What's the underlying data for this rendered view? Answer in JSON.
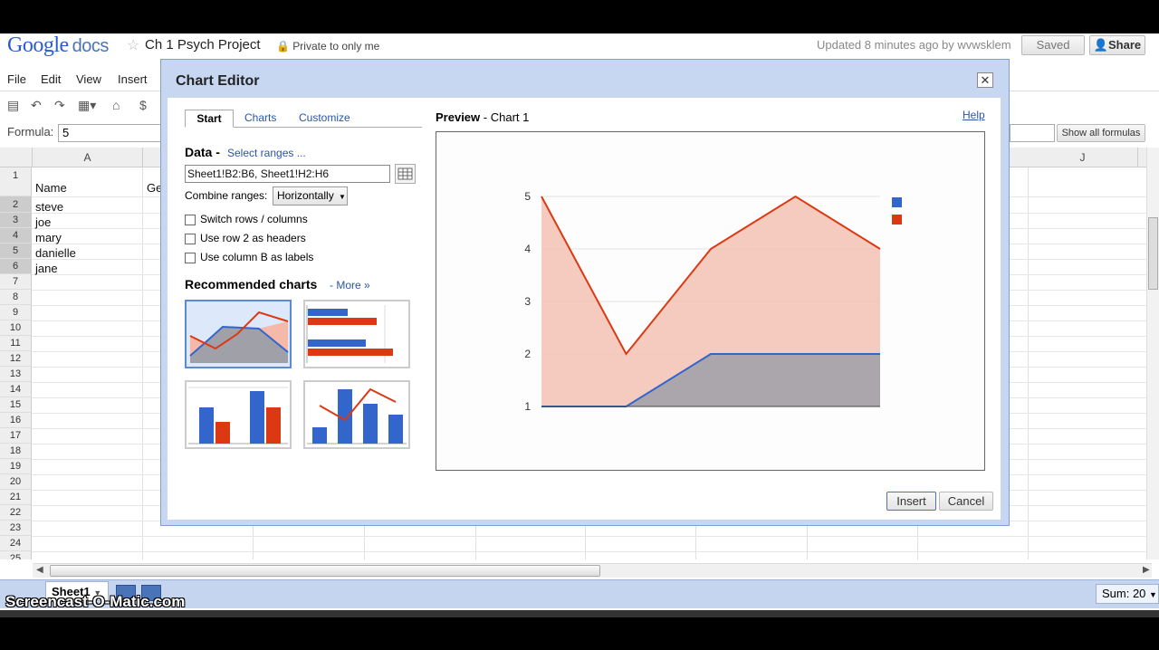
{
  "header": {
    "logo_google": "Google",
    "logo_docs": "docs",
    "doc_title": "Ch 1 Psych Project",
    "privacy": "Private to only me",
    "updated": "Updated 8 minutes ago by wvwsklem",
    "saved_label": "Saved",
    "share_label": "Share"
  },
  "menu": [
    "File",
    "Edit",
    "View",
    "Insert"
  ],
  "formula": {
    "label": "Formula:",
    "value": "5",
    "show_all_label": "Show all formulas"
  },
  "grid": {
    "columns": [
      "A",
      "J"
    ],
    "partial_header": "Ge",
    "header_cell": "Name",
    "rows": [
      "1",
      "2",
      "3",
      "4",
      "5",
      "6",
      "7",
      "8",
      "9",
      "10",
      "11",
      "12",
      "13",
      "14",
      "15",
      "16",
      "17",
      "18",
      "19",
      "20",
      "21",
      "22",
      "23",
      "24",
      "25"
    ],
    "names": [
      "steve",
      "joe",
      "mary",
      "danielle",
      "jane"
    ]
  },
  "footer": {
    "sheet_tab": "Sheet1",
    "sum": "Sum: 20",
    "watermark": "Screencast-O-Matic.com"
  },
  "dialog": {
    "title": "Chart Editor",
    "tabs": [
      "Start",
      "Charts",
      "Customize"
    ],
    "data_label": "Data -",
    "select_ranges": "Select ranges ...",
    "range_value": "Sheet1!B2:B6, Sheet1!H2:H6",
    "combine_label": "Combine ranges:",
    "combine_value": "Horizontally",
    "checkboxes": [
      "Switch rows / columns",
      "Use row 2 as headers",
      "Use column B as labels"
    ],
    "recommended_label": "Recommended charts",
    "more_link": "- More »",
    "preview_label": "Preview",
    "preview_name": "- Chart 1",
    "help_label": "Help",
    "insert_label": "Insert",
    "cancel_label": "Cancel"
  },
  "colors": {
    "series_red": "#dc3912",
    "series_blue": "#3366cc",
    "dialog_frame": "#c7d7f2"
  },
  "chart_data": {
    "type": "area",
    "x": [
      1,
      2,
      3,
      4,
      5
    ],
    "series": [
      {
        "values": [
          1,
          1,
          2,
          2,
          2
        ]
      },
      {
        "values": [
          5,
          2,
          4,
          5,
          4
        ]
      }
    ],
    "ylim": [
      1,
      5
    ],
    "yticks": [
      "1",
      "2",
      "3",
      "4",
      "5"
    ],
    "grid": true,
    "legend": "right"
  }
}
